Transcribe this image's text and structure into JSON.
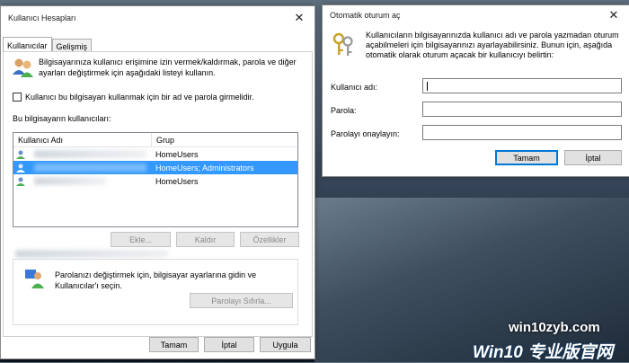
{
  "left_window": {
    "title": "Kullanıcı Hesapları",
    "tabs": [
      {
        "label": "Kullanıcılar",
        "active": true
      },
      {
        "label": "Gelişmiş",
        "active": false
      }
    ],
    "intro_text": "Bilgisayarınıza kullanıcı erişimine izin vermek/kaldırmak, parola ve diğer ayarları değiştirmek için aşağıdaki listeyi kullanın.",
    "checkbox_label": "Kullanıcı bu bilgisayarı kullanmak için bir ad ve parola girmelidir.",
    "checkbox_checked": false,
    "users_label": "Bu bilgisayarın kullanıcıları:",
    "columns": [
      "Kullanıcı Adı",
      "Grup"
    ],
    "rows": [
      {
        "group": "HomeUsers",
        "selected": false
      },
      {
        "group": "HomeUsers; Administrators",
        "selected": true
      },
      {
        "group": "HomeUsers",
        "selected": false
      }
    ],
    "buttons": {
      "add": "Ekle...",
      "remove": "Kaldır",
      "properties": "Özellikler"
    },
    "password_text": "Parolanızı değiştirmek için, bilgisayar ayarlarına gidin ve Kullanıcılar'ı seçin.",
    "reset_password_button": "Parolayı Sıfırla...",
    "footer": {
      "ok": "Tamam",
      "cancel": "İptal",
      "apply": "Uygula"
    }
  },
  "right_window": {
    "title": "Otomatik oturum aç",
    "description": "Kullanıcıların bilgisayarınızda kullanıcı adı ve parola yazmadan oturum açabilmeleri için bilgisayarınızı ayarlayabilirsiniz. Bunun için, aşağıda otomatik olarak oturum açacak bir kullanıcıyı belirtin:",
    "fields": [
      {
        "label": "Kullanıcı adı:",
        "value": ""
      },
      {
        "label": "Parola:",
        "value": ""
      },
      {
        "label": "Parolayı onaylayın:",
        "value": ""
      }
    ],
    "ok": "Tamam",
    "cancel": "İptal"
  },
  "watermark": {
    "top": "win10zyb.com",
    "bottom": "Win10 专业版官网"
  },
  "colors": {
    "selection": "#3399ff",
    "focus": "#0078d7"
  }
}
